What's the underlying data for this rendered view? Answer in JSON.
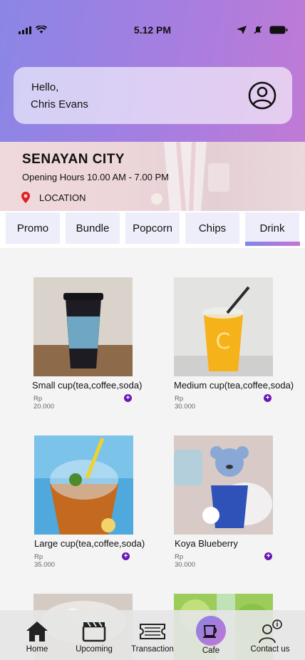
{
  "status_bar": {
    "time": "5.12 PM"
  },
  "greeting": {
    "line1": "Hello,",
    "line2": "Chris Evans"
  },
  "venue": {
    "name": "SENAYAN CITY",
    "hours": "Opening Hours 10.00 AM - 7.00 PM",
    "location_label": "LOCATION"
  },
  "tabs": [
    {
      "label": "Promo"
    },
    {
      "label": "Bundle"
    },
    {
      "label": "Popcorn"
    },
    {
      "label": "Chips"
    },
    {
      "label": "Drink",
      "active": true
    }
  ],
  "products": [
    {
      "name": "Small cup(tea,coffee,soda)",
      "price": "Rp 20.000"
    },
    {
      "name": "Medium cup(tea,coffee,soda)",
      "price": "Rp 30.000"
    },
    {
      "name": "Large cup(tea,coffee,soda)",
      "price": "Rp 35.000"
    },
    {
      "name": "Koya Blueberry",
      "price": "Rp 30.000"
    }
  ],
  "bottom_nav": [
    {
      "label": "Home",
      "icon": "home-icon"
    },
    {
      "label": "Upcoming",
      "icon": "clapperboard-icon"
    },
    {
      "label": "Transaction",
      "icon": "ticket-icon"
    },
    {
      "label": "Cafe",
      "icon": "coffee-cup-icon",
      "active": true
    },
    {
      "label": "Contact us",
      "icon": "support-agent-icon"
    }
  ],
  "colors": {
    "accent_start": "#8a86e6",
    "accent_end": "#c07ad6",
    "add_button": "#6a18b5",
    "location_pin": "#e02020"
  }
}
